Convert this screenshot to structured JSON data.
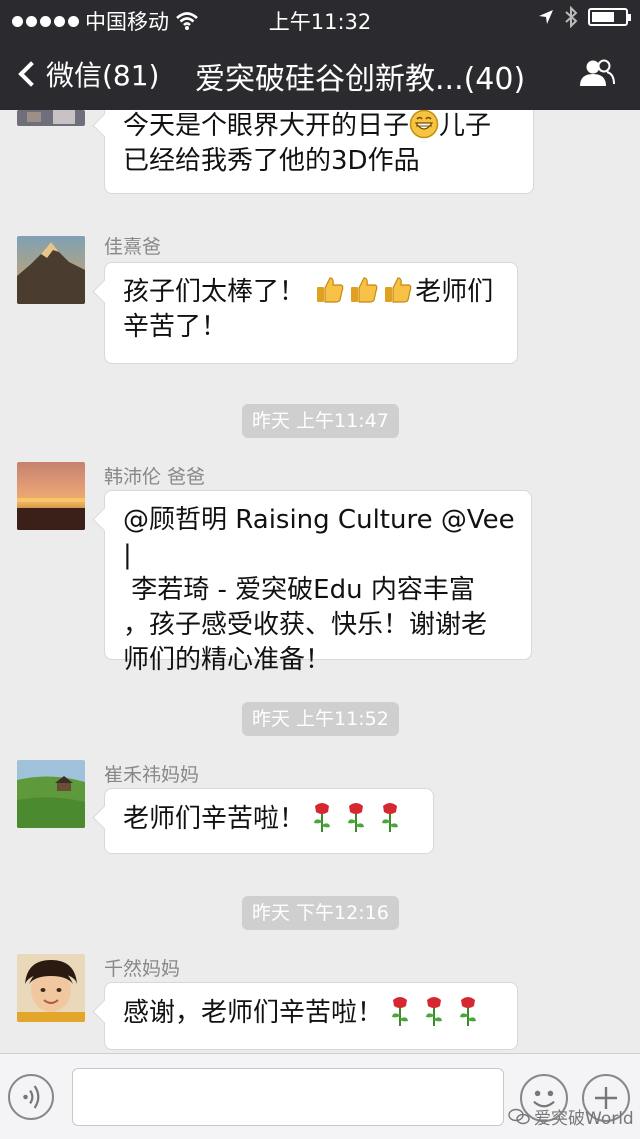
{
  "status_bar": {
    "carrier": "中国移动",
    "time": "上午11:32"
  },
  "nav": {
    "back_label": "微信(81)",
    "title": "爱突破硅谷创新教...(40)"
  },
  "messages": [
    {
      "sender": "",
      "text1": "今天是个眼界大开的日子",
      "text2": "儿子",
      "text3": "已经给我秀了他的3D作品"
    },
    {
      "sender": "佳熹爸",
      "text1": "孩子们太棒了！",
      "text2": "老师们",
      "text3": "辛苦了！"
    },
    {
      "timestamp": "昨天 上午11:47"
    },
    {
      "sender": "韩沛伦 爸爸",
      "line1": "@顾哲明 Raising Culture @Vee |",
      "line2": " 李若琦 - 爱突破Edu 内容丰富",
      "line3": "，孩子感受收获、快乐！谢谢老",
      "line4": "师们的精心准备！"
    },
    {
      "timestamp": "昨天 上午11:52"
    },
    {
      "sender": "崔禾祎妈妈",
      "text": "老师们辛苦啦！"
    },
    {
      "timestamp": "昨天 下午12:16"
    },
    {
      "sender": "千然妈妈",
      "text": "感谢，老师们辛苦啦！"
    }
  ],
  "watermark": "爱突破World",
  "icons": [
    "signal-dots",
    "wifi-icon",
    "location-icon",
    "bluetooth-icon",
    "battery-icon",
    "back-chevron-icon",
    "group-members-icon",
    "voice-icon",
    "emoji-icon",
    "plus-icon",
    "grin-emoji",
    "thumbs-up-emoji",
    "rose-emoji"
  ]
}
